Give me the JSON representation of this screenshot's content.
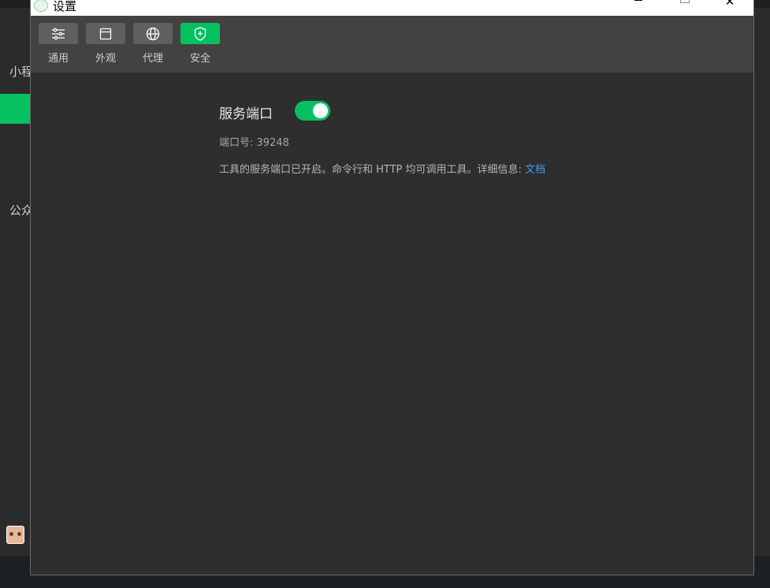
{
  "window": {
    "title": "设置",
    "controls": [
      "minimize",
      "maximize",
      "close"
    ],
    "close_glyph": "✕"
  },
  "background_app": {
    "sidebar_items": [
      "小程",
      "公众"
    ]
  },
  "toolbar": {
    "tabs": [
      {
        "label": "通用",
        "icon": "sliders-icon",
        "active": false
      },
      {
        "label": "外观",
        "icon": "window-icon",
        "active": false
      },
      {
        "label": "代理",
        "icon": "globe-icon",
        "active": false
      },
      {
        "label": "安全",
        "icon": "shield-icon",
        "active": true
      }
    ]
  },
  "security": {
    "service_port_title": "服务端口",
    "service_port_enabled": true,
    "port_label": "端口号:",
    "port_value": "39248",
    "description": "工具的服务端口已开启。命令行和 HTTP 均可调用工具。详细信息:",
    "doc_link": "文档"
  },
  "colors": {
    "accent": "#07c160",
    "link": "#3c9df0",
    "panel": "#2e2e2e",
    "toolbar": "#424242"
  }
}
